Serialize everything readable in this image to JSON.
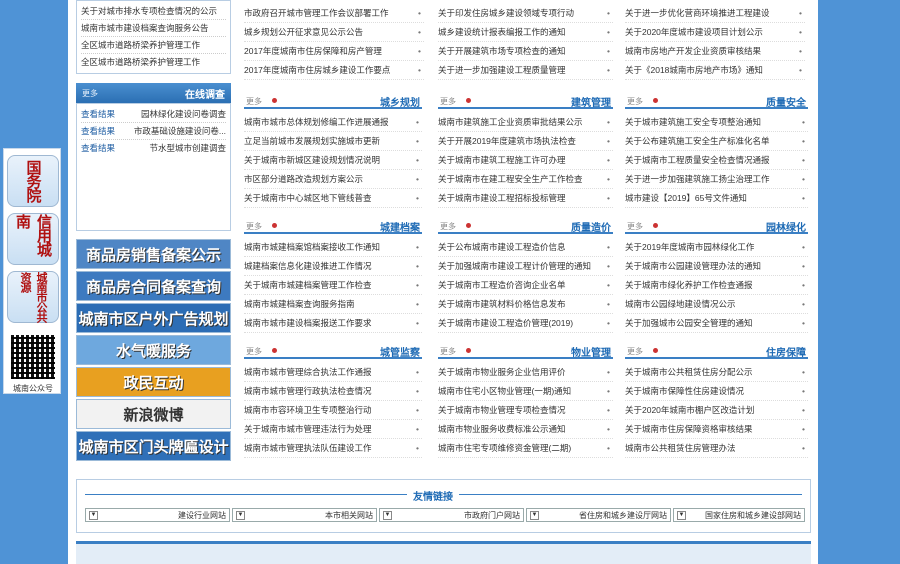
{
  "left_top_list": [
    "关于对城市排水专项检查情况的公示",
    "城南市城市建设档案查询服务公告",
    "全区城市道路桥梁养护管理工作",
    "全区城市道路桥梁养护管理工作"
  ],
  "survey": {
    "title": "在线调查",
    "more": "更多",
    "items": [
      {
        "label": "园林绿化建设问卷调查",
        "vote": "查看结果"
      },
      {
        "label": "市政基础设施建设问卷...",
        "vote": "查看结果"
      },
      {
        "label": "节水型城市创建调查",
        "vote": "查看结果"
      }
    ]
  },
  "banners": [
    {
      "label": "商品房销售备案公示",
      "color": "#4f86c5"
    },
    {
      "label": "商品房合同备案查询",
      "color": "#3d7ac0"
    },
    {
      "label": "城南市区户外广告规划",
      "color": "#2c6db5"
    },
    {
      "label": "水气暖服务",
      "color": "#6ea8de"
    },
    {
      "label": "政民互动",
      "color": "#e8a020"
    },
    {
      "label": "新浪微博",
      "color": "#f2f2f2"
    },
    {
      "label": "城南市区门头牌匾设计",
      "color": "#2f70b8"
    }
  ],
  "floatbar": {
    "tiles": [
      "国务院",
      "信用城南",
      "城南市公共资源"
    ],
    "qr_label": "城南公众号"
  },
  "top_lists": {
    "col1": [
      "市政府召开城市管理工作会议部署工作",
      "城乡规划公开征求意见公示公告",
      "2017年度城南市住房保障和房产管理",
      "2017年度城南市住房城乡建设工作要点"
    ],
    "col2": [
      "关于印发住房城乡建设领域专项行动",
      "城乡建设统计报表编报工作的通知",
      "关于开展建筑市场专项检查的通知",
      "关于进一步加强建设工程质量管理"
    ],
    "col3": [
      "关于进一步优化营商环境推进工程建设",
      "关于2020年度城市建设项目计划公示",
      "城南市房地产开发企业资质审核结果",
      "关于《2018城南市房地产市场》通知"
    ]
  },
  "sections": [
    {
      "name": "质量安全",
      "more": "更多",
      "items": [
        "关于城市建筑施工安全专项整治通知",
        "关于公布建筑施工安全生产标准化名单",
        "关于城南市工程质量安全检查情况通报",
        "关于进一步加强建筑施工扬尘治理工作",
        "城市建设【2019】65号文件通知"
      ]
    },
    {
      "name": "建筑管理",
      "more": "更多",
      "items": [
        "城南市建筑施工企业资质审批结果公示",
        "关于开展2019年度建筑市场执法检查",
        "关于城南市建筑工程施工许可办理",
        "关于城南市在建工程安全生产工作检查",
        "关于城南市建设工程招标投标管理"
      ]
    },
    {
      "name": "城乡规划",
      "more": "更多",
      "items": [
        "城南市城市总体规划修编工作进展通报",
        "立足当前城市发展规划实施城市更新",
        "关于城南市新城区建设规划情况说明",
        "市区部分道路改造规划方案公示",
        "关于城南市中心城区地下管线普查"
      ]
    },
    {
      "name": "园林绿化",
      "more": "更多",
      "items": [
        "关于2019年度城南市园林绿化工作",
        "关于城南市公园建设管理办法的通知",
        "关于城南市绿化养护工作检查通报",
        "城南市公园绿地建设情况公示",
        "关于加强城市公园安全管理的通知"
      ]
    },
    {
      "name": "质量造价",
      "more": "更多",
      "items": [
        "关于公布城南市建设工程造价信息",
        "关于加强城南市建设工程计价管理的通知",
        "关于城南市工程造价咨询企业名单",
        "关于城南市建筑材料价格信息发布",
        "关于城南市建设工程造价管理(2019)"
      ]
    },
    {
      "name": "城建档案",
      "more": "更多",
      "items": [
        "城南市城建档案馆档案接收工作通知",
        "城建档案信息化建设推进工作情况",
        "关于城南市城建档案管理工作检查",
        "城南市城建档案查询服务指南",
        "城南市城市建设档案报送工作要求"
      ]
    },
    {
      "name": "住房保障",
      "more": "更多",
      "items": [
        "关于城南市公共租赁住房分配公示",
        "关于城南市保障性住房建设情况",
        "关于2020年城南市棚户区改造计划",
        "关于城南市住房保障资格审核结果",
        "城南市公共租赁住房管理办法"
      ]
    },
    {
      "name": "物业管理",
      "more": "更多",
      "items": [
        "关于城南市物业服务企业信用评价",
        "城南市住宅小区物业管理(一期)通知",
        "关于城南市物业管理专项检查情况",
        "城南市物业服务收费标准公示通知",
        "城南市住宅专项维修资金管理(二期)"
      ]
    },
    {
      "name": "城管监察",
      "more": "更多",
      "items": [
        "城南市城市管理综合执法工作通报",
        "城南市城市管理行政执法检查情况",
        "城南市市容环境卫生专项整治行动",
        "关于城南市城市管理违法行为处理",
        "城南市城市管理执法队伍建设工作"
      ]
    }
  ],
  "links": {
    "title": "友情链接",
    "selects": [
      "国家住房和城乡建设部网站",
      "省住房和城乡建设厅网站",
      "市政府门户网站",
      "本市相关网站",
      "建设行业网站"
    ]
  }
}
